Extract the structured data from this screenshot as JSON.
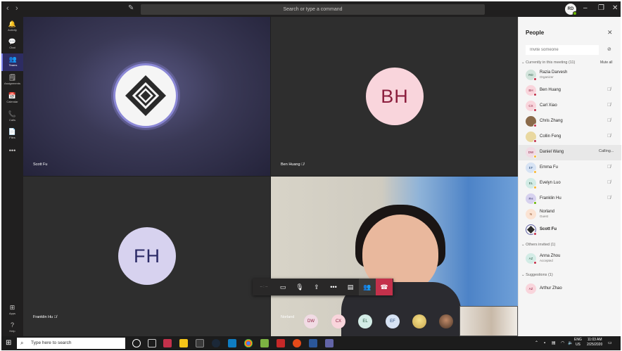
{
  "titlebar": {
    "back": "‹",
    "forward": "›",
    "search_placeholder": "Search or type a command",
    "me_initials": "RD",
    "minimize": "–",
    "maximize": "❐",
    "close": "✕"
  },
  "rail": [
    {
      "label": "Activity",
      "icon": "bell-icon",
      "glyph": "🔔"
    },
    {
      "label": "Chat",
      "icon": "chat-icon",
      "glyph": "💬"
    },
    {
      "label": "Teams",
      "icon": "teams-icon",
      "glyph": "👥"
    },
    {
      "label": "Assignments",
      "icon": "assignments-icon",
      "glyph": "🗒"
    },
    {
      "label": "Calendar",
      "icon": "calendar-icon",
      "glyph": "📅"
    },
    {
      "label": "Calls",
      "icon": "phone-icon",
      "glyph": "📞"
    },
    {
      "label": "Files",
      "icon": "files-icon",
      "glyph": "📄"
    },
    {
      "label": "",
      "icon": "more-icon",
      "glyph": "•••"
    },
    {
      "label": "Apps",
      "icon": "apps-icon",
      "glyph": "⊞"
    },
    {
      "label": "Help",
      "icon": "help-icon",
      "glyph": "?"
    }
  ],
  "tiles": {
    "t1_name": "Scott Fu",
    "t2_name": "Ben Huang",
    "t2_initials": "BH",
    "t3_name": "Franklin Hu",
    "t3_initials": "FH",
    "t4_name": "Norland"
  },
  "controls": {
    "timer": "-- : --",
    "camera": "▭",
    "mic": "🎙",
    "share": "⇪",
    "more": "•••",
    "chat": "▤",
    "people": "👥",
    "hangup": "☎"
  },
  "mini_avatars": [
    "DW",
    "CX",
    "EL",
    "EF"
  ],
  "people_panel": {
    "title": "People",
    "close": "✕",
    "invite_placeholder": "Invite someone",
    "section_current": "Currently in this meeting (11)",
    "mute_all": "Mute all",
    "section_others": "Others invited (1)",
    "section_suggestions": "Suggestions (1)",
    "calling": "Calling...",
    "participants": [
      {
        "initials": "RD",
        "name": "Razia Darvesh",
        "sub": "Organizer",
        "bg": "#d3e4dc",
        "fg": "#2e5d46",
        "dot": "#c4314b"
      },
      {
        "initials": "BH",
        "name": "Ben Huang",
        "sub": "",
        "bg": "#f9d5dc",
        "fg": "#8c1f3e",
        "dot": "#c4314b"
      },
      {
        "initials": "CX",
        "name": "Carl Xiao",
        "sub": "",
        "bg": "#f9d5dc",
        "fg": "#8c1f3e",
        "dot": "#c4314b"
      },
      {
        "initials": "",
        "name": "Chris Zhang",
        "sub": "",
        "bg": "#8a6a4a",
        "fg": "#fff",
        "dot": "#c4314b"
      },
      {
        "initials": "",
        "name": "Collin Feng",
        "sub": "",
        "bg": "#e9d8a0",
        "fg": "#fff",
        "dot": "#c4314b"
      },
      {
        "initials": "DW",
        "name": "Daniel Wang",
        "sub": "",
        "bg": "#f1dbe4",
        "fg": "#8c1f3e",
        "dot": "#f8b830"
      },
      {
        "initials": "EF",
        "name": "Emma Fu",
        "sub": "",
        "bg": "#d7e3f4",
        "fg": "#2b4e7c",
        "dot": "#f8b830"
      },
      {
        "initials": "EL",
        "name": "Evelyn Luo",
        "sub": "",
        "bg": "#d3ece6",
        "fg": "#2e5d46",
        "dot": "#f8b830"
      },
      {
        "initials": "FH",
        "name": "Franklin Hu",
        "sub": "",
        "bg": "#d7d2ef",
        "fg": "#2b2a66",
        "dot": "#6bb700"
      },
      {
        "initials": "N",
        "name": "Norland",
        "sub": "Guest",
        "bg": "#fbe3d3",
        "fg": "#8a4b22",
        "dot": ""
      },
      {
        "initials": "",
        "name": "Scott Fu",
        "sub": "",
        "bg": "#f5f5f5",
        "fg": "#333",
        "dot": "#c4314b"
      }
    ],
    "invited": {
      "initials": "AZ",
      "name": "Anna Zhou",
      "sub": "Accepted"
    },
    "suggestion": {
      "initials": "AZ",
      "name": "Arthur Zhao"
    }
  },
  "taskbar": {
    "start": "⊞",
    "search_placeholder": "Type here to search",
    "search_icon": "⌕",
    "lang_top": "ENG",
    "lang_bottom": "US",
    "time": "11:03 AM",
    "date": "2/25/2020"
  },
  "colors": {
    "accent": "#6264a7",
    "hangup": "#c4314b",
    "available": "#6bb700",
    "away": "#f8b830"
  }
}
